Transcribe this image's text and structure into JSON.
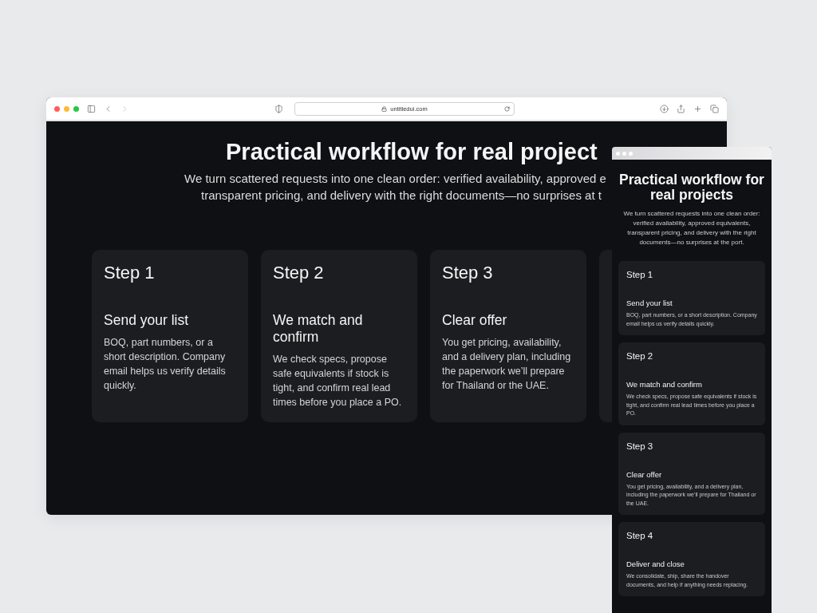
{
  "browser": {
    "url": "untitledui.com"
  },
  "desktop": {
    "title": "Practical workflow for real project",
    "subtitle_lines": [
      "We turn scattered requests into one clean order: verified availability, approved e",
      "transparent pricing, and delivery with the right documents—no surprises at t"
    ],
    "steps": [
      {
        "kind": "card",
        "step": "Step 1",
        "title": "Send your list",
        "body": "BOQ, part numbers, or a short description. Company email helps us verify details quickly."
      },
      {
        "kind": "card",
        "step": "Step 2",
        "title": "We match and confirm",
        "body": "We check specs, propose safe equivalents if stock is tight, and confirm real lead times before you place a PO."
      },
      {
        "kind": "card",
        "step": "Step 3",
        "title": "Clear offer",
        "body": "You get pricing, availability, and a delivery plan, including the paperwork we’ll prepare for Thailand or the UAE."
      },
      {
        "kind": "hidden"
      }
    ]
  },
  "mobile": {
    "title": "Practical workflow for real projects",
    "subtitle": "We turn scattered requests into one clean order: verified availability, approved equivalents, transparent pricing, and delivery with the right documents—no surprises at the port.",
    "steps": [
      {
        "step": "Step 1",
        "title": "Send your list",
        "body": "BOQ, part numbers, or a short description. Company email helps us verify details quickly."
      },
      {
        "step": "Step 2",
        "title": "We match and confirm",
        "body": "We check specs, propose safe equivalents if stock is tight, and confirm real lead times before you place a PO."
      },
      {
        "step": "Step 3",
        "title": "Clear offer",
        "body": "You get pricing, availability, and a delivery plan, including the paperwork we’ll prepare for Thailand or the UAE."
      },
      {
        "step": "Step 4",
        "title": "Deliver and close",
        "body": "We consolidate, ship, share the handover documents, and help if anything needs replacing."
      }
    ]
  }
}
